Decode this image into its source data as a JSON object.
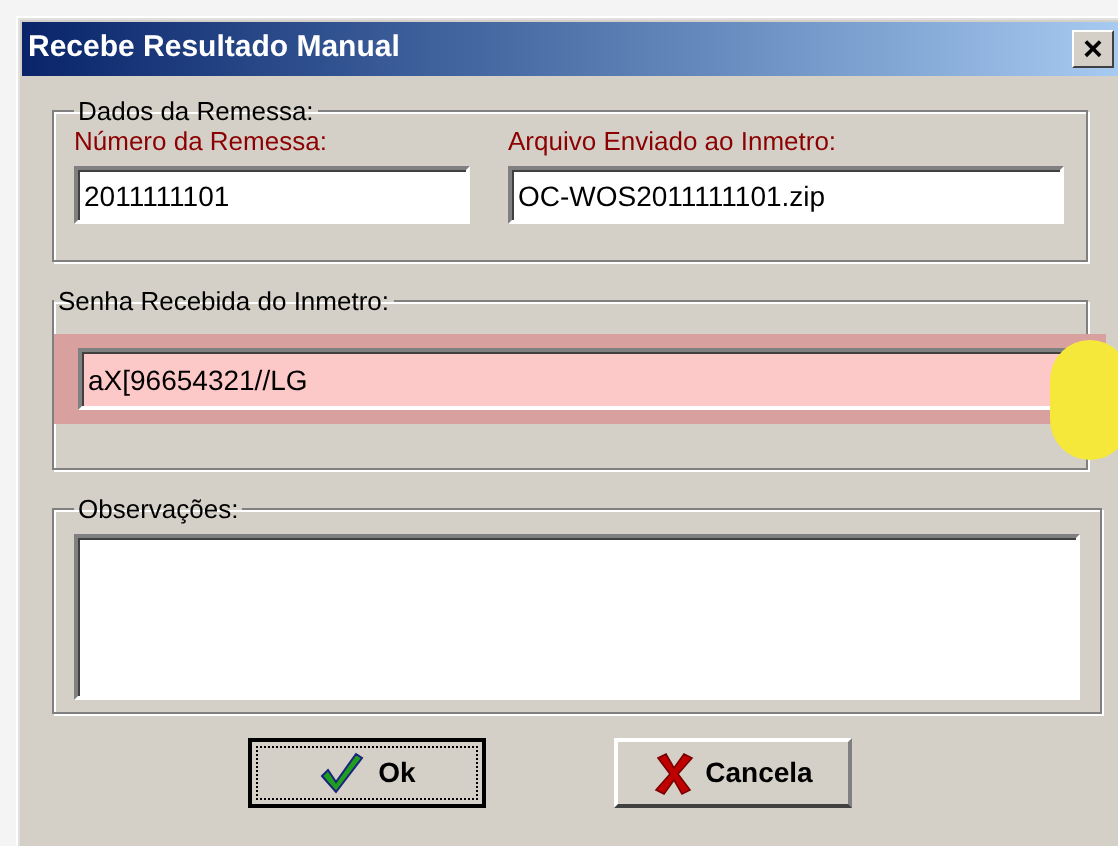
{
  "window": {
    "title": "Recebe Resultado Manual",
    "close": "×"
  },
  "remessa": {
    "legend": "Dados da Remessa:",
    "numero_label": "Número da Remessa:",
    "numero_value": "2011111101",
    "arquivo_label": "Arquivo Enviado ao Inmetro:",
    "arquivo_value": "OC-WOS2011111101.zip"
  },
  "senha": {
    "legend": "Senha Recebida do Inmetro:",
    "value": "aX[96654321//LG",
    "highlighted": true
  },
  "observacoes": {
    "legend": "Observações:"
  },
  "buttons": [
    {
      "kind": "ok",
      "label": "Ok",
      "focused": true
    },
    {
      "kind": "cancel",
      "label": "Cancela",
      "focused": false
    }
  ]
}
